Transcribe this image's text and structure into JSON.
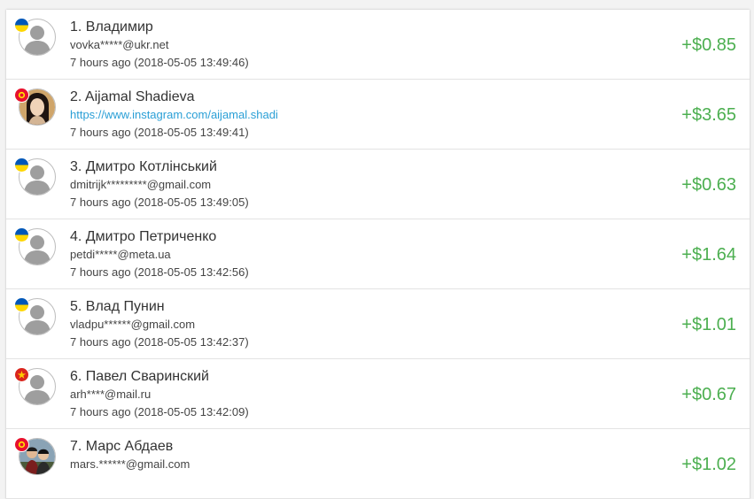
{
  "colors": {
    "amount_green": "#4caf50",
    "link_blue": "#2a9fd6",
    "ukraine_blue": "#0057b8",
    "ukraine_yellow": "#ffd700",
    "red": "#ce1126"
  },
  "payouts": [
    {
      "name": "1. Владимир",
      "contact": "vovka*****@ukr.net",
      "time": "7 hours ago (2018-05-05 13:49:46)",
      "amount": "+$0.85",
      "avatar_icon": "default-user-icon",
      "flag_icon": "ukraine-flag-icon"
    },
    {
      "name": "2. Aijamal Shadieva",
      "contact": "https://www.instagram.com/aijamal.shadi",
      "time": "7 hours ago (2018-05-05 13:49:41)",
      "amount": "+$3.65",
      "avatar_icon": "user-photo-icon",
      "flag_icon": "kyrgyzstan-flag-icon"
    },
    {
      "name": "3. Дмитро Котлінський",
      "contact": "dmitrijk*********@gmail.com",
      "time": "7 hours ago (2018-05-05 13:49:05)",
      "amount": "+$0.63",
      "avatar_icon": "default-user-icon",
      "flag_icon": "ukraine-flag-icon"
    },
    {
      "name": "4. Дмитро Петриченко",
      "contact": "petdi*****@meta.ua",
      "time": "7 hours ago (2018-05-05 13:42:56)",
      "amount": "+$1.64",
      "avatar_icon": "default-user-icon",
      "flag_icon": "ukraine-flag-icon"
    },
    {
      "name": "5. Влад Пунин",
      "contact": "vladpu******@gmail.com",
      "time": "7 hours ago (2018-05-05 13:42:37)",
      "amount": "+$1.01",
      "avatar_icon": "default-user-icon",
      "flag_icon": "ukraine-flag-icon"
    },
    {
      "name": "6. Павел Сваринский",
      "contact": "arh****@mail.ru",
      "time": "7 hours ago (2018-05-05 13:42:09)",
      "amount": "+$0.67",
      "avatar_icon": "default-user-icon",
      "flag_icon": "vietnam-flag-icon"
    },
    {
      "name": "7. Марс Абдаев",
      "contact": "mars.******@gmail.com",
      "time": "",
      "amount": "+$1.02",
      "avatar_icon": "couple-photo-icon",
      "flag_icon": "kyrgyzstan-flag-icon"
    }
  ]
}
